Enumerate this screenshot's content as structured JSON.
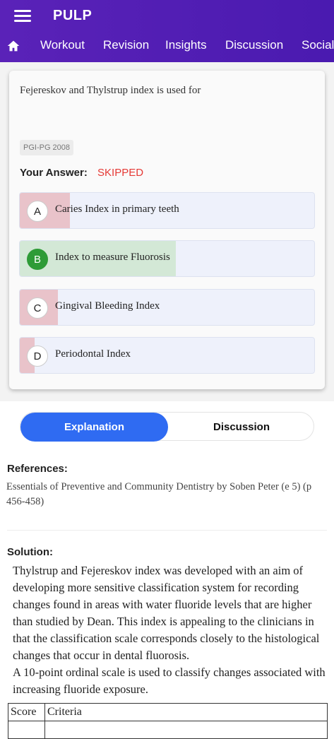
{
  "app": {
    "title": "PULP"
  },
  "nav": {
    "items": [
      {
        "label": "Workout"
      },
      {
        "label": "Revision"
      },
      {
        "label": "Insights"
      },
      {
        "label": "Discussion"
      },
      {
        "label": "Social"
      }
    ]
  },
  "question": {
    "text": "Fejereskov and Thylstrup index is used for",
    "tag": "PGI-PG 2008",
    "your_answer_label": "Your Answer:",
    "your_answer_value": "SKIPPED"
  },
  "options": [
    {
      "letter": "A",
      "text": "Caries Index in primary teeth",
      "percent": 17,
      "correct": false
    },
    {
      "letter": "B",
      "text": "Index to measure Fluorosis",
      "percent": 53,
      "correct": true
    },
    {
      "letter": "C",
      "text": "Gingival Bleeding Index",
      "percent": 13,
      "correct": false
    },
    {
      "letter": "D",
      "text": "Periodontal Index",
      "percent": 5,
      "correct": false
    }
  ],
  "colors": {
    "wrong_fill": "#e9c3ca",
    "correct_fill": "#d3e8d6",
    "accent": "#2f6bf2",
    "header": "#5a22b8"
  },
  "tabs": {
    "explanation": "Explanation",
    "discussion": "Discussion"
  },
  "references": {
    "heading": "References:",
    "text": "Essentials of Preventive and Community Dentistry by Soben Peter (e 5) (p 456-458)"
  },
  "solution": {
    "heading": "Solution:",
    "para1": "Thylstrup and Fejereskov index was developed with an aim of developing more sensitive classification system for recording changes found in areas with water fluoride levels that are higher than studied by Dean. This index is appealing to the clinicians in that the classification scale corresponds closely to the histological changes that occur in dental fluorosis.",
    "para2": "A 10-point ordinal scale is used to classify changes associated with increasing fluoride exposure.",
    "table_headers": {
      "score": "Score",
      "criteria": "Criteria"
    }
  }
}
